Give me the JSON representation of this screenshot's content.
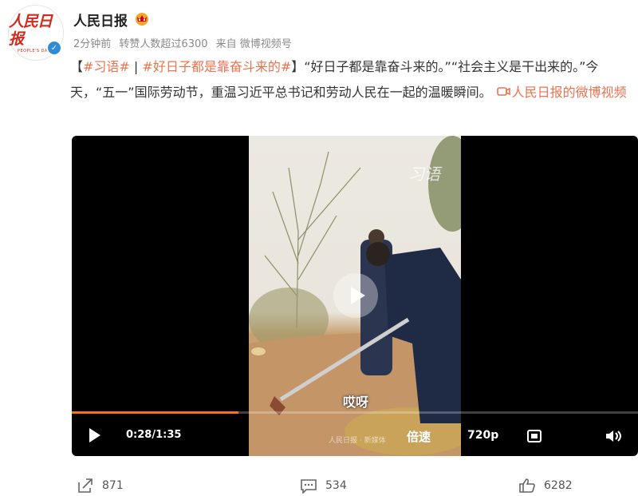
{
  "account": {
    "logo_cn": "人民日报",
    "logo_en": "PEOPLE'S DAILY",
    "name": "人民日报"
  },
  "meta": {
    "time": "2分钟前",
    "reposts": "转赞人数超过6300",
    "source": "来自 微博视频号"
  },
  "post": {
    "open_bracket": "【",
    "tag1": "#习语#",
    "separator": " | ",
    "tag2": "#好日子都是靠奋斗来的#",
    "close_bracket": "】",
    "body": "“好日子都是靠奋斗来的。”“社会主义是干出来的。”今天，“五一”国际劳动节，重温习近平总书记和劳动人民在一起的温暖瞬间。",
    "video_link": "人民日报的微博视频"
  },
  "video": {
    "subtitle": "哎呀",
    "watermark_top": "习语",
    "watermark_bottom": "人民日报 · 新媒体",
    "time": "0:28/1:35",
    "progress": 0.295,
    "speed": "倍速",
    "quality": "720p"
  },
  "actions": {
    "share": "871",
    "comment": "534",
    "like": "6282"
  },
  "colors": {
    "accent": "#eb7350",
    "progress": "#f77215"
  }
}
